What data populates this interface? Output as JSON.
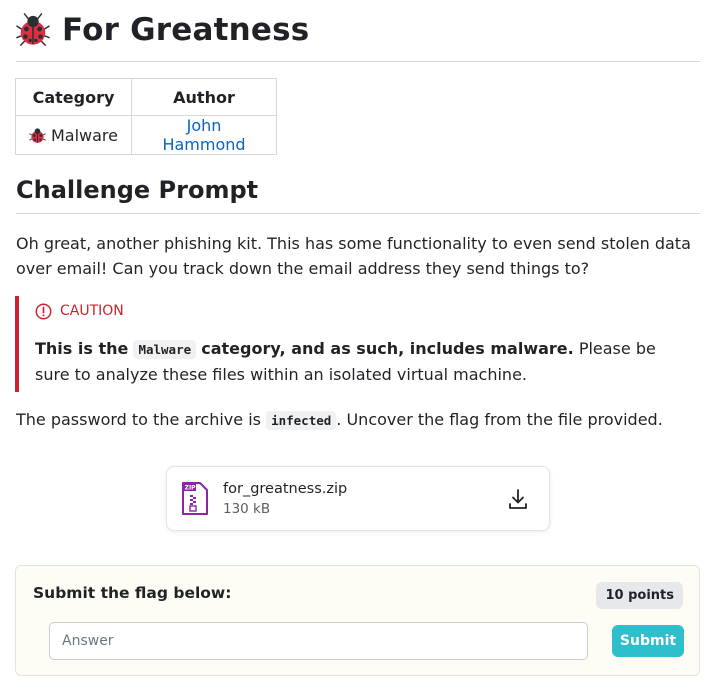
{
  "page": {
    "title": "For Greatness",
    "title_icon": "ladybug-icon"
  },
  "info_table": {
    "headers": [
      "Category",
      "Author"
    ],
    "category": "Malware",
    "category_icon": "ladybug-icon",
    "author": "John Hammond"
  },
  "prompt": {
    "heading": "Challenge Prompt",
    "text": "Oh great, another phishing kit. This has some functionality to even send stolen data over email! Can you track down the email address they send things to?"
  },
  "caution": {
    "label": "CAUTION",
    "icon": "alert-circle-icon",
    "bold_prefix": "This is the",
    "code": "Malware",
    "bold_suffix": "category, and as such, includes malware.",
    "rest": "Please be sure to analyze these files within an isolated virtual machine.",
    "accent_color": "#cf222e"
  },
  "password": {
    "prefix": "The password to the archive is",
    "code": "infected",
    "suffix": ". Uncover the flag from the file provided."
  },
  "file": {
    "name": "for_greatness.zip",
    "size": "130 kB",
    "icon": "zip-file-icon",
    "action_icon": "download-icon",
    "icon_color": "#8e24aa"
  },
  "submit": {
    "label": "Submit the flag below:",
    "points": "10 points",
    "placeholder": "Answer",
    "button": "Submit",
    "button_color": "#2fbecb"
  }
}
